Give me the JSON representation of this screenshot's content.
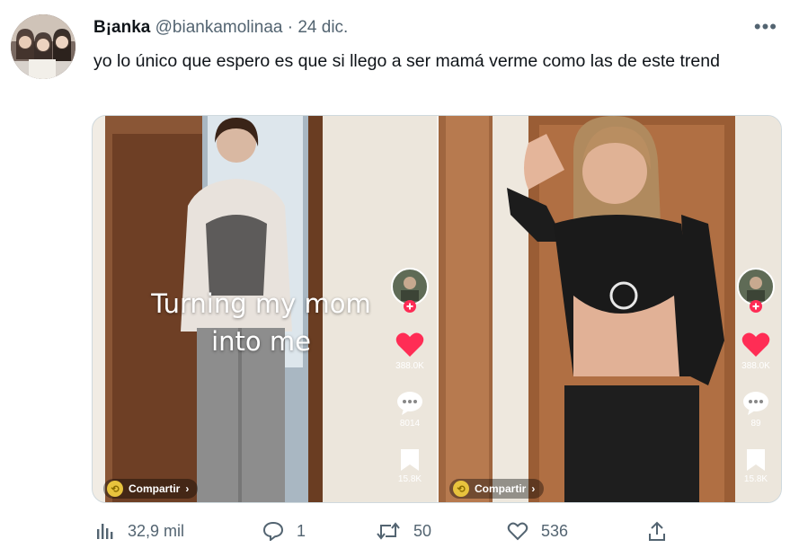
{
  "tweet": {
    "display_name": "B¡anka",
    "handle": "@biankamolinaa",
    "separator": "·",
    "date": "24 dic.",
    "more_label": "•••",
    "text": "yo lo único que espero es que si llego a ser mamá verme como las de este trend"
  },
  "media": {
    "left": {
      "overlay_line1": "Turning my mom",
      "overlay_line2": "into me",
      "likes": "388.0K",
      "comments": "8014",
      "saves": "15.8K",
      "share_label": "Compartir"
    },
    "right": {
      "likes": "388.0K",
      "comments": "89",
      "saves": "15.8K",
      "share_label": "Compartir"
    }
  },
  "actions": {
    "views": "32,9 mil",
    "replies": "1",
    "retweets": "50",
    "likes": "536"
  },
  "colors": {
    "muted": "#536471",
    "text": "#0f1419",
    "tiktok_heart": "#ff2d55",
    "tiktok_plus": "#fe2c55"
  }
}
